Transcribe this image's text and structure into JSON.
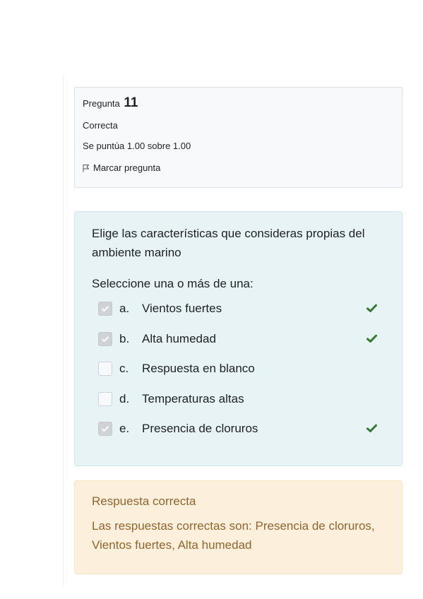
{
  "info": {
    "question_label": "Pregunta",
    "question_number": "11",
    "state": "Correcta",
    "grade": "Se puntúa 1.00 sobre 1.00",
    "flag_label": "Marcar pregunta"
  },
  "question": {
    "text": "Elige las características que consideras propias del ambiente marino",
    "prompt": "Seleccione una o más de una:",
    "answers": [
      {
        "letter": "a.",
        "text": "Vientos fuertes",
        "checked": true,
        "correct": true
      },
      {
        "letter": "b.",
        "text": "Alta humedad",
        "checked": true,
        "correct": true
      },
      {
        "letter": "c.",
        "text": "Respuesta en blanco",
        "checked": false,
        "correct": false
      },
      {
        "letter": "d.",
        "text": "Temperaturas altas",
        "checked": false,
        "correct": false
      },
      {
        "letter": "e.",
        "text": "Presencia de cloruros",
        "checked": true,
        "correct": true
      }
    ]
  },
  "feedback": {
    "title": "Respuesta correcta",
    "right_answer": "Las respuestas correctas son: Presencia de cloruros, Vientos fuertes, Alta humedad"
  },
  "colors": {
    "correct_tick": "#357a32",
    "feedback_text": "#8e662e",
    "formulation_bg": "#e7f3f5",
    "feedback_bg": "#fcefdc"
  },
  "icons": {
    "flag": "flag-icon",
    "tick": "check-icon"
  }
}
